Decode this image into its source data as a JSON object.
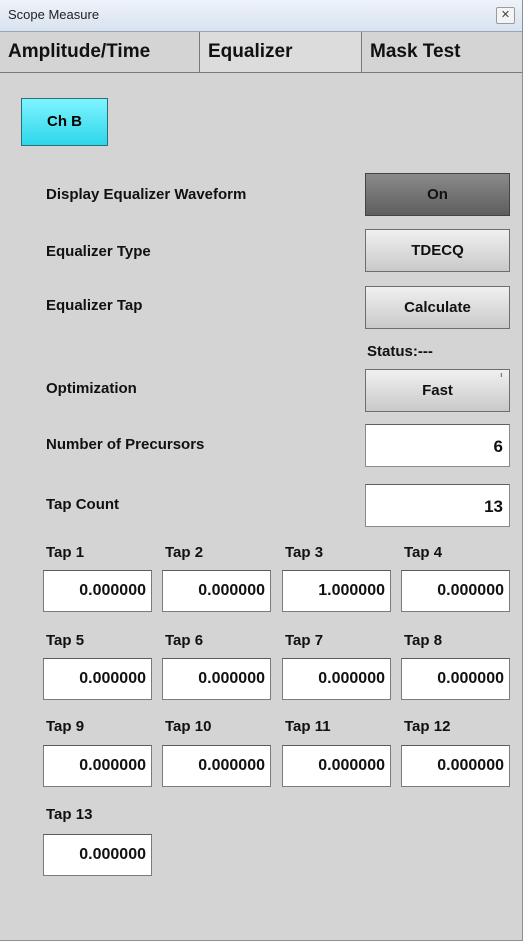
{
  "window": {
    "title": "Scope Measure",
    "close_glyph": "✕"
  },
  "tabs": [
    {
      "label": "Amplitude/Time"
    },
    {
      "label": "Equalizer"
    },
    {
      "label": "Mask Test"
    }
  ],
  "channel_button": {
    "label": "Ch B",
    "color": "#3fe3f3"
  },
  "settings": {
    "display_waveform": {
      "label": "Display Equalizer Waveform",
      "value": "On"
    },
    "equalizer_type": {
      "label": "Equalizer Type",
      "value": "TDECQ"
    },
    "equalizer_tap": {
      "label": "Equalizer Tap",
      "value": "Calculate"
    },
    "status": "Status:---",
    "optimization": {
      "label": "Optimization",
      "value": "Fast"
    },
    "num_precursors": {
      "label": "Number of Precursors",
      "value": "6"
    },
    "tap_count": {
      "label": "Tap Count",
      "value": "13"
    }
  },
  "taps": [
    {
      "label": "Tap 1",
      "value": "0.000000"
    },
    {
      "label": "Tap 2",
      "value": "0.000000"
    },
    {
      "label": "Tap 3",
      "value": "1.000000"
    },
    {
      "label": "Tap 4",
      "value": "0.000000"
    },
    {
      "label": "Tap 5",
      "value": "0.000000"
    },
    {
      "label": "Tap 6",
      "value": "0.000000"
    },
    {
      "label": "Tap 7",
      "value": "0.000000"
    },
    {
      "label": "Tap 8",
      "value": "0.000000"
    },
    {
      "label": "Tap 9",
      "value": "0.000000"
    },
    {
      "label": "Tap 10",
      "value": "0.000000"
    },
    {
      "label": "Tap 11",
      "value": "0.000000"
    },
    {
      "label": "Tap 12",
      "value": "0.000000"
    },
    {
      "label": "Tap 13",
      "value": "0.000000"
    }
  ]
}
